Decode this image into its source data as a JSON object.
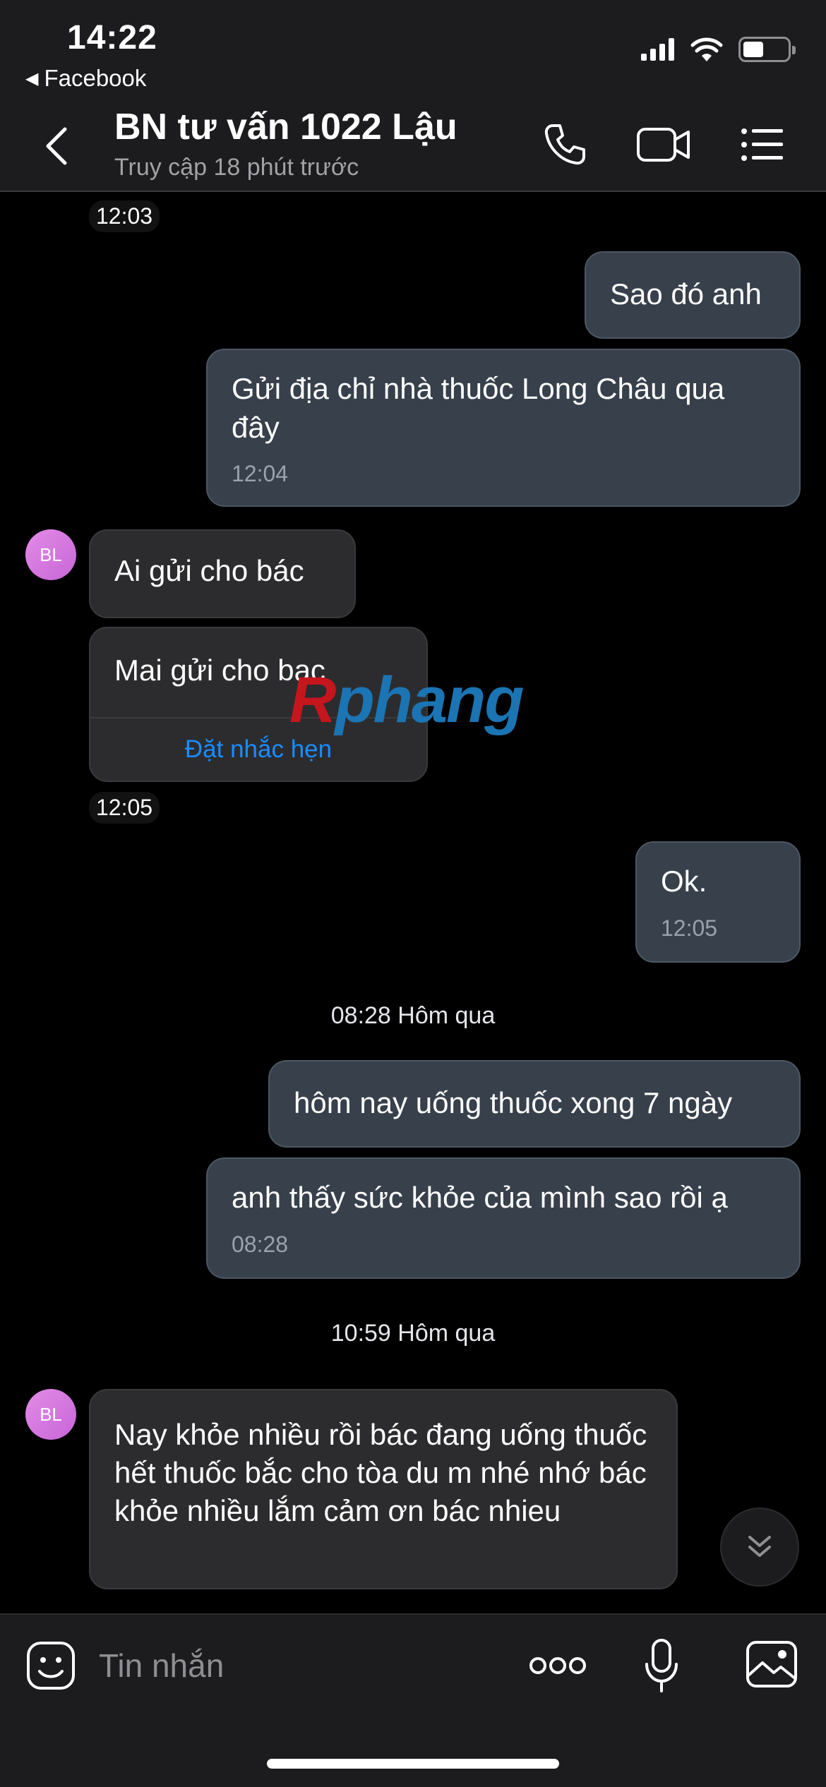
{
  "status_bar": {
    "time": "14:22",
    "back_app": "Facebook"
  },
  "header": {
    "title": "BN tư vấn 1022 Lậu",
    "subtitle": "Truy cập 18 phút trước"
  },
  "messages": {
    "ts1": "12:03",
    "out1": "Sao đó anh",
    "out2": "Gửi địa chỉ nhà thuốc Long Châu qua đây",
    "out2_time": "12:04",
    "avatar_initials": "BL",
    "in1": "Ai gửi cho bác",
    "in2": "Mai gửi cho bac",
    "in2_action": "Đặt nhắc hẹn",
    "ts2": "12:05",
    "out3": "Ok.",
    "out3_time": "12:05",
    "sep1": "08:28 Hôm qua",
    "out4": "hôm nay uống thuốc xong 7 ngày",
    "out5": "anh thấy sức khỏe  của mình sao rồi ạ",
    "out5_time": "08:28",
    "sep2": "10:59 Hôm qua",
    "in3": "Nay khỏe nhiều rồi bác đang uống thuốc  hết  thuốc bắc cho tòa du m nhé nhớ bác  khỏe nhiều lắm cảm ơn bác nhieu"
  },
  "watermark": {
    "first": "R",
    "rest": "phang"
  },
  "input": {
    "placeholder": "Tin nhắn"
  },
  "colors": {
    "outgoing_bubble": "#37404b",
    "incoming_bubble": "#2c2c2e",
    "link": "#1a8cff",
    "avatar": "#d37ade"
  }
}
